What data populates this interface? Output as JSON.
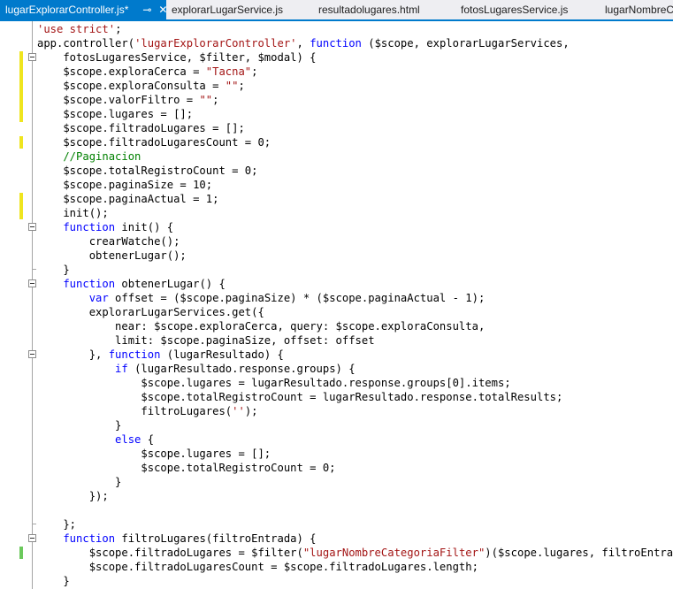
{
  "tabs": [
    {
      "label": "lugarExplorarController.js*",
      "active": true
    },
    {
      "label": "explorarLugarService.js",
      "active": false
    },
    {
      "label": "resultadolugares.html",
      "active": false
    },
    {
      "label": "fotosLugaresService.js",
      "active": false
    },
    {
      "label": "lugarNombreC",
      "active": false
    }
  ],
  "tab_icons": {
    "pin": "pin-icon",
    "close": "close-icon"
  },
  "colors": {
    "accent": "#007acc",
    "keyword": "#0000ff",
    "string": "#a31515",
    "comment": "#008000",
    "changed": "#efe51f",
    "saved": "#6bc95c"
  },
  "code_lines": [
    [
      {
        "t": "s",
        "v": "'use strict'"
      },
      {
        "t": "p",
        "v": ";"
      }
    ],
    [
      {
        "t": "p",
        "v": "app.controller("
      },
      {
        "t": "s",
        "v": "'lugarExplorarController'"
      },
      {
        "t": "p",
        "v": ", "
      },
      {
        "t": "k",
        "v": "function"
      },
      {
        "t": "p",
        "v": " ($scope, explorarLugarServices,"
      }
    ],
    [
      {
        "t": "p",
        "v": "    fotosLugaresService, $filter, $modal) {"
      }
    ],
    [
      {
        "t": "p",
        "v": "    $scope.exploraCerca = "
      },
      {
        "t": "s",
        "v": "\"Tacna\""
      },
      {
        "t": "p",
        "v": ";"
      }
    ],
    [
      {
        "t": "p",
        "v": "    $scope.exploraConsulta = "
      },
      {
        "t": "s",
        "v": "\"\""
      },
      {
        "t": "p",
        "v": ";"
      }
    ],
    [
      {
        "t": "p",
        "v": "    $scope.valorFiltro = "
      },
      {
        "t": "s",
        "v": "\"\""
      },
      {
        "t": "p",
        "v": ";"
      }
    ],
    [
      {
        "t": "p",
        "v": "    $scope.lugares = [];"
      }
    ],
    [
      {
        "t": "p",
        "v": "    $scope.filtradoLugares = [];"
      }
    ],
    [
      {
        "t": "p",
        "v": "    $scope.filtradoLugaresCount = 0;"
      }
    ],
    [
      {
        "t": "c",
        "v": "    //Paginacion"
      }
    ],
    [
      {
        "t": "p",
        "v": "    $scope.totalRegistroCount = 0;"
      }
    ],
    [
      {
        "t": "p",
        "v": "    $scope.paginaSize = 10;"
      }
    ],
    [
      {
        "t": "p",
        "v": "    $scope.paginaActual = 1;"
      }
    ],
    [
      {
        "t": "p",
        "v": "    init();"
      }
    ],
    [
      {
        "t": "k",
        "v": "    function"
      },
      {
        "t": "p",
        "v": " init() {"
      }
    ],
    [
      {
        "t": "p",
        "v": "        crearWatche();"
      }
    ],
    [
      {
        "t": "p",
        "v": "        obtenerLugar();"
      }
    ],
    [
      {
        "t": "p",
        "v": "    }"
      }
    ],
    [
      {
        "t": "k",
        "v": "    function"
      },
      {
        "t": "p",
        "v": " obtenerLugar() {"
      }
    ],
    [
      {
        "t": "k",
        "v": "        var"
      },
      {
        "t": "p",
        "v": " offset = ($scope.paginaSize) * ($scope.paginaActual - 1);"
      }
    ],
    [
      {
        "t": "p",
        "v": "        explorarLugarServices.get({"
      }
    ],
    [
      {
        "t": "p",
        "v": "            near: $scope.exploraCerca, query: $scope.exploraConsulta,"
      }
    ],
    [
      {
        "t": "p",
        "v": "            limit: $scope.paginaSize, offset: offset"
      }
    ],
    [
      {
        "t": "p",
        "v": "        }, "
      },
      {
        "t": "k",
        "v": "function"
      },
      {
        "t": "p",
        "v": " (lugarResultado) {"
      }
    ],
    [
      {
        "t": "k",
        "v": "            if"
      },
      {
        "t": "p",
        "v": " (lugarResultado.response.groups) {"
      }
    ],
    [
      {
        "t": "p",
        "v": "                $scope.lugares = lugarResultado.response.groups[0].items;"
      }
    ],
    [
      {
        "t": "p",
        "v": "                $scope.totalRegistroCount = lugarResultado.response.totalResults;"
      }
    ],
    [
      {
        "t": "p",
        "v": "                filtroLugares("
      },
      {
        "t": "s",
        "v": "''"
      },
      {
        "t": "p",
        "v": ");"
      }
    ],
    [
      {
        "t": "p",
        "v": "            }"
      }
    ],
    [
      {
        "t": "k",
        "v": "            else"
      },
      {
        "t": "p",
        "v": " {"
      }
    ],
    [
      {
        "t": "p",
        "v": "                $scope.lugares = [];"
      }
    ],
    [
      {
        "t": "p",
        "v": "                $scope.totalRegistroCount = 0;"
      }
    ],
    [
      {
        "t": "p",
        "v": "            }"
      }
    ],
    [
      {
        "t": "p",
        "v": "        });"
      }
    ],
    [
      {
        "t": "p",
        "v": ""
      }
    ],
    [
      {
        "t": "p",
        "v": "    };"
      }
    ],
    [
      {
        "t": "k",
        "v": "    function"
      },
      {
        "t": "p",
        "v": " filtroLugares(filtroEntrada) {"
      }
    ],
    [
      {
        "t": "p",
        "v": "        $scope.filtradoLugares = $filter("
      },
      {
        "t": "s",
        "v": "\"lugarNombreCategoriaFilter\""
      },
      {
        "t": "p",
        "v": ")($scope.lugares, filtroEntrada);"
      }
    ],
    [
      {
        "t": "p",
        "v": "        $scope.filtradoLugaresCount = $scope.filtradoLugares.length;"
      }
    ],
    [
      {
        "t": "p",
        "v": "    }"
      }
    ]
  ]
}
